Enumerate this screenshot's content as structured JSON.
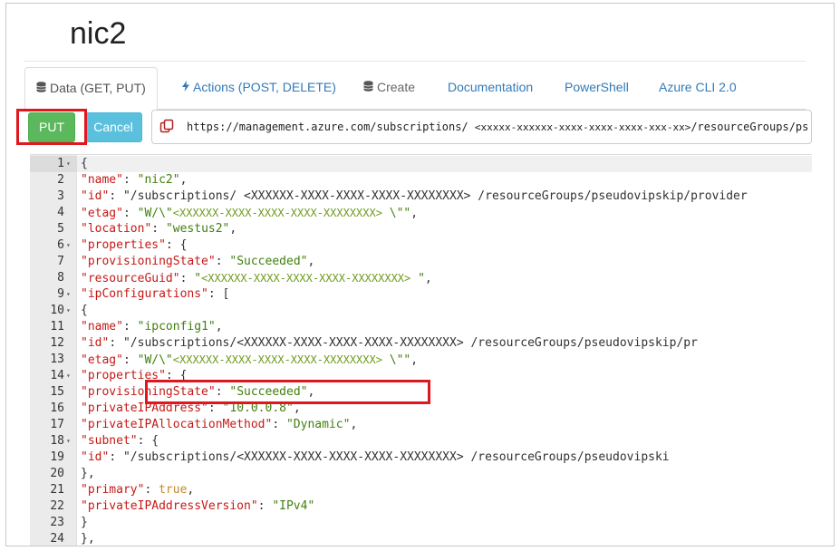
{
  "page": {
    "title": "nic2"
  },
  "tabs": [
    {
      "label": "Data (GET, PUT)",
      "icon": "database-icon",
      "active": true
    },
    {
      "label": "Actions (POST, DELETE)",
      "icon": "bolt-icon"
    },
    {
      "label": "Create",
      "icon": "database-icon"
    },
    {
      "label": "Documentation"
    },
    {
      "label": "PowerShell"
    },
    {
      "label": "Azure CLI 2.0"
    }
  ],
  "toolbar": {
    "put_label": "PUT",
    "cancel_label": "Cancel"
  },
  "url": {
    "prefix": "https://management.azure.com/subscriptions/",
    "placeholder": "<xxxxx-xxxxxx-xxxx-xxxx-xxxx-xxx-xx>",
    "suffix": "/resourceGroups/ps"
  },
  "editor": {
    "lines": [
      {
        "n": "1",
        "fold": "▾",
        "text": "{"
      },
      {
        "n": "2",
        "text": "  \"name\": \"nic2\","
      },
      {
        "n": "3",
        "text": "  \"id\": \"/subscriptions/ <XXXXXX-XXXX-XXXX-XXXX-XXXXXXXX> /resourceGroups/pseudovipskip/provider"
      },
      {
        "n": "4",
        "text": "  \"etag\": \"W/\\\"<XXXXXX-XXXX-XXXX-XXXX-XXXXXXXX>  \\\"\","
      },
      {
        "n": "5",
        "text": "  \"location\": \"westus2\","
      },
      {
        "n": "6",
        "fold": "▾",
        "text": "  \"properties\": {"
      },
      {
        "n": "7",
        "text": "    \"provisioningState\": \"Succeeded\","
      },
      {
        "n": "8",
        "text": "    \"resourceGuid\": \"<XXXXXX-XXXX-XXXX-XXXX-XXXXXXXX>  \","
      },
      {
        "n": "9",
        "fold": "▾",
        "text": "    \"ipConfigurations\": ["
      },
      {
        "n": "10",
        "fold": "▾",
        "text": "      {"
      },
      {
        "n": "11",
        "text": "        \"name\": \"ipconfig1\","
      },
      {
        "n": "12",
        "text": "        \"id\": \"/subscriptions/<XXXXXX-XXXX-XXXX-XXXX-XXXXXXXX> /resourceGroups/pseudovipskip/pr"
      },
      {
        "n": "13",
        "text": "        \"etag\": \"W/\\\"<XXXXXX-XXXX-XXXX-XXXX-XXXXXXXX> \\\"\","
      },
      {
        "n": "14",
        "fold": "▾",
        "text": "        \"properties\": {"
      },
      {
        "n": "15",
        "text": "          \"provisioningState\": \"Succeeded\","
      },
      {
        "n": "16",
        "text": "          \"privateIPAddress\": \"10.0.0.8\","
      },
      {
        "n": "17",
        "text": "          \"privateIPAllocationMethod\": \"Dynamic\","
      },
      {
        "n": "18",
        "fold": "▾",
        "text": "          \"subnet\": {"
      },
      {
        "n": "19",
        "text": "            \"id\": \"/subscriptions/<XXXXXX-XXXX-XXXX-XXXX-XXXXXXXX> /resourceGroups/pseudovipski"
      },
      {
        "n": "20",
        "text": "          },"
      },
      {
        "n": "21",
        "text": "          \"primary\": true,"
      },
      {
        "n": "22",
        "text": "          \"privateIPAddressVersion\": \"IPv4\""
      },
      {
        "n": "23",
        "text": "        }"
      },
      {
        "n": "24",
        "text": "      },"
      }
    ]
  },
  "colors": {
    "put_green": "#5cb85c",
    "cancel_blue": "#5bc0de",
    "highlight_red": "#e0171f",
    "json_key": "#c41a16",
    "json_string": "#41800f",
    "json_bool": "#c5872d",
    "link_blue": "#337ab7"
  }
}
